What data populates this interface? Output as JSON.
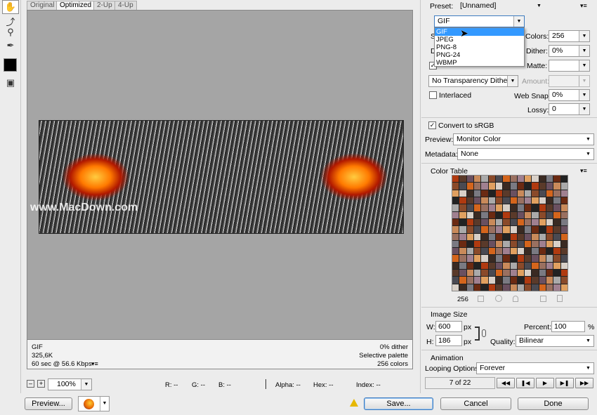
{
  "tools": [
    "hand-icon",
    "slice-select-icon",
    "zoom-icon",
    "eyedropper-icon",
    "color-swatch",
    "toggle-slices-icon"
  ],
  "tabs": [
    "Original",
    "Optimized",
    "2-Up",
    "4-Up"
  ],
  "watermark": "www.MacDown.com",
  "status": {
    "format": "GIF",
    "size": "325,6K",
    "time": "60 sec @ 56.6 Kbps",
    "dither": "0% dither",
    "palette": "Selective palette",
    "colors": "256 colors"
  },
  "bottom": {
    "zoom": "100%",
    "r": "R: --",
    "g": "G: --",
    "b": "B: --",
    "alpha": "Alpha: --",
    "hex": "Hex: --",
    "index": "Index: --"
  },
  "buttons": {
    "preview": "Preview...",
    "save": "Save...",
    "cancel": "Cancel",
    "done": "Done"
  },
  "panel": {
    "preset_label": "Preset:",
    "preset_value": "[Unnamed]",
    "format_value": "GIF",
    "format_options": [
      "GIF",
      "JPEG",
      "PNG-8",
      "PNG-24",
      "WBMP"
    ],
    "colors_label": "Colors:",
    "colors_value": "256",
    "dither_label": "Dither:",
    "dither_value": "0%",
    "matte_label": "Matte:",
    "transparency_dither": "No Transparency Dither",
    "amount_label": "Amount:",
    "interlaced_label": "Interlaced",
    "websnap_label": "Web Snap:",
    "websnap_value": "0%",
    "lossy_label": "Lossy:",
    "lossy_value": "0",
    "srgb_label": "Convert to sRGB",
    "preview_label": "Preview:",
    "preview_value": "Monitor Color",
    "metadata_label": "Metadata:",
    "metadata_value": "None",
    "color_table_title": "Color Table",
    "color_count": "256",
    "image_size_title": "Image Size",
    "w_label": "W:",
    "w_value": "600",
    "h_label": "H:",
    "h_value": "186",
    "px": "px",
    "percent_label": "Percent:",
    "percent_value": "100",
    "percent_unit": "%",
    "quality_label": "Quality:",
    "quality_value": "Bilinear",
    "animation_title": "Animation",
    "looping_label": "Looping Options:",
    "looping_value": "Forever",
    "frame_counter": "7 of 22"
  },
  "partial_labels": {
    "s": "S",
    "d": "D"
  },
  "colors": {
    "accent": "#3399ff",
    "canvas": "#a5a5a5",
    "eye": "#ff7a00"
  }
}
